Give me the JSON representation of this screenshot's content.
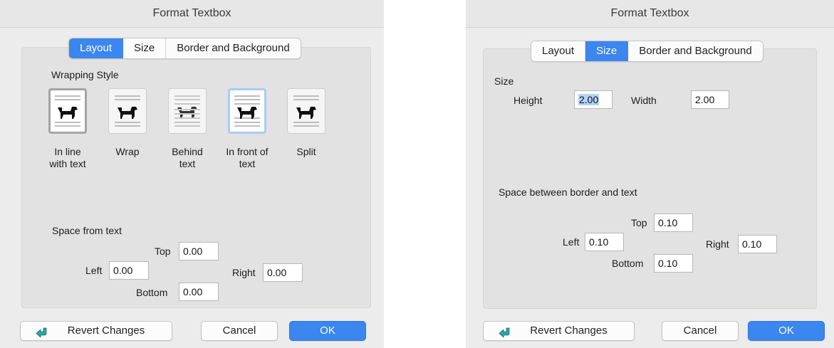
{
  "layout_dialog": {
    "title": "Format Textbox",
    "tabs": [
      "Layout",
      "Size",
      "Border and Background"
    ],
    "active_tab": "Layout",
    "wrapping_style_label": "Wrapping Style",
    "wrapping_options": [
      {
        "label": "In line\nwith text",
        "icon": "dog-inline-icon",
        "state": "selected"
      },
      {
        "label": "Wrap",
        "icon": "dog-wrap-icon",
        "state": "normal"
      },
      {
        "label": "Behind\ntext",
        "icon": "dog-behind-text-icon",
        "state": "normal"
      },
      {
        "label": "In front of\ntext",
        "icon": "dog-in-front-icon",
        "state": "highlighted"
      },
      {
        "label": "Split",
        "icon": "dog-split-icon",
        "state": "normal"
      }
    ],
    "space_label": "Space from text",
    "top_label": "Top",
    "top_value": "0.00",
    "left_label": "Left",
    "left_value": "0.00",
    "right_label": "Right",
    "right_value": "0.00",
    "bottom_label": "Bottom",
    "bottom_value": "0.00"
  },
  "size_dialog": {
    "title": "Format Textbox",
    "tabs": [
      "Layout",
      "Size",
      "Border and Background"
    ],
    "active_tab": "Size",
    "size_label": "Size",
    "height_label": "Height",
    "height_value": "2.00",
    "width_label": "Width",
    "width_value": "2.00",
    "space_label": "Space between border and text",
    "top_label": "Top",
    "top_value": "0.10",
    "left_label": "Left",
    "left_value": "0.10",
    "right_label": "Right",
    "right_value": "0.10",
    "bottom_label": "Bottom",
    "bottom_value": "0.10"
  },
  "buttons": {
    "revert": "Revert Changes",
    "revert_icon": "revert-arrow-icon",
    "cancel": "Cancel",
    "ok": "OK"
  },
  "colors": {
    "accent": "#3b86ef",
    "dialog_bg": "#ececec",
    "arrow": "#2aa7a0"
  }
}
